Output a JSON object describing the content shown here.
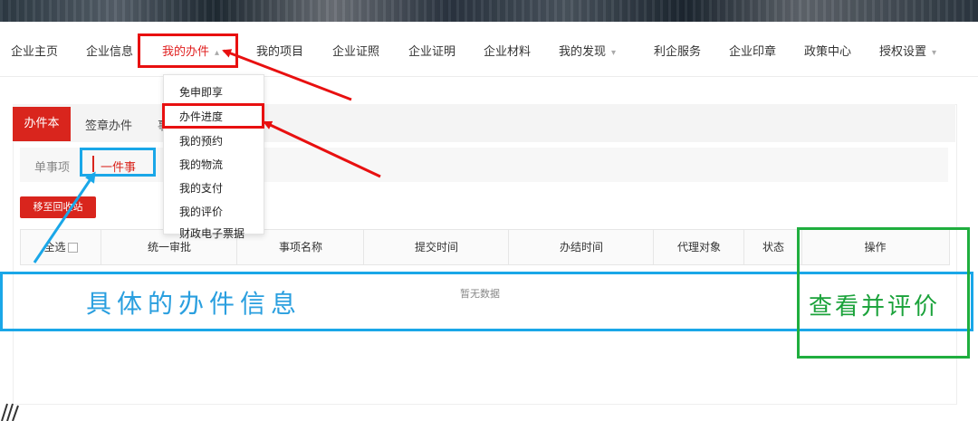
{
  "nav": {
    "items": [
      {
        "label": "企业主页"
      },
      {
        "label": "企业信息"
      },
      {
        "label": "我的办件"
      },
      {
        "label": "我的项目"
      },
      {
        "label": "企业证照"
      },
      {
        "label": "企业证明"
      },
      {
        "label": "企业材料"
      },
      {
        "label": "我的发现"
      },
      {
        "label": "利企服务"
      },
      {
        "label": "企业印章"
      },
      {
        "label": "政策中心"
      },
      {
        "label": "授权设置"
      }
    ]
  },
  "dropdown": {
    "items": [
      "免申即享",
      "办件进度",
      "我的预约",
      "我的物流",
      "我的支付",
      "我的评价",
      "财政电子票据"
    ]
  },
  "tabs": [
    "办件本",
    "签章办件",
    "事"
  ],
  "subtabs": [
    "单事项",
    "一件事"
  ],
  "actions": {
    "recycle": "移至回收站"
  },
  "table": {
    "select_all": "全选",
    "headers": [
      "统一审批",
      "事项名称",
      "提交时间",
      "办结时间",
      "代理对象",
      "状态",
      "操作"
    ],
    "empty": "暂无数据"
  },
  "annotations": {
    "detail_label": "具体的办件信息",
    "action_label": "查看并评价"
  },
  "colors": {
    "accent_red": "#d9251d",
    "annotation_red": "#e81010",
    "annotation_blue": "#1aa7e8",
    "annotation_green": "#1fae3e"
  }
}
